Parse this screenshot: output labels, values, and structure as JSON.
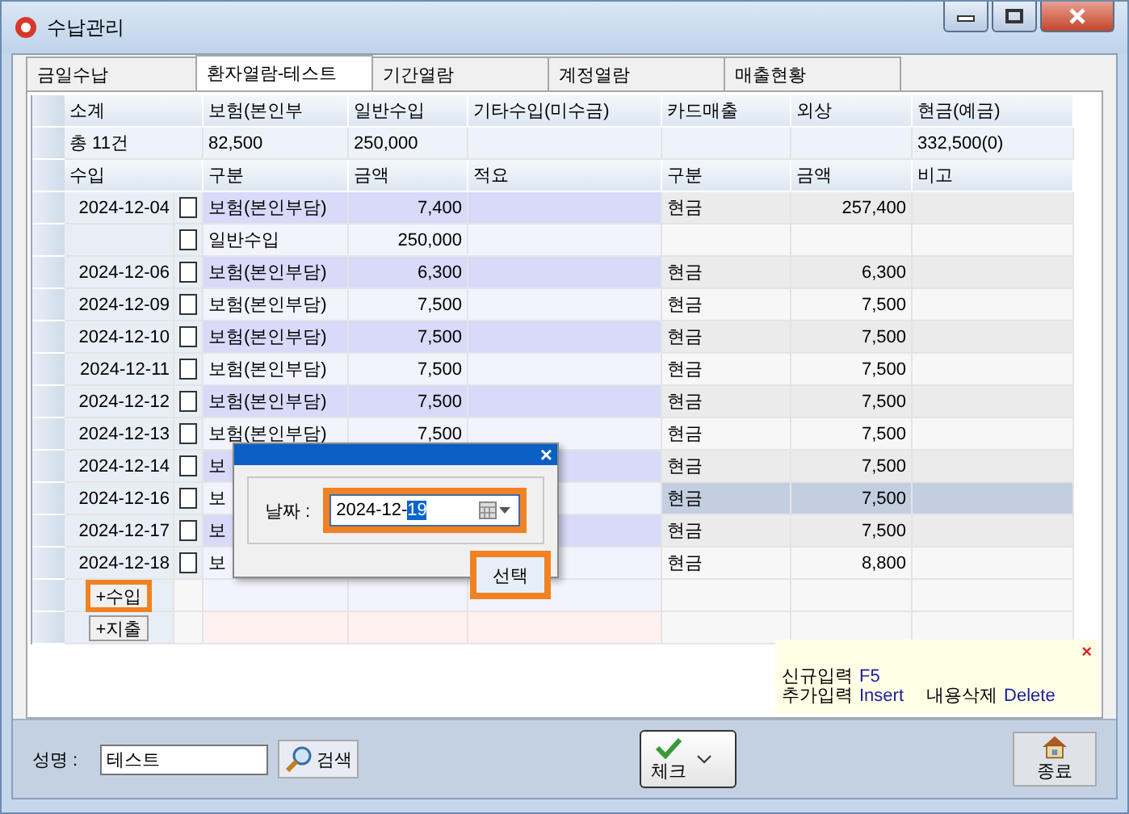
{
  "window": {
    "title": "수납관리"
  },
  "tabs": [
    {
      "label": "금일수납",
      "selected": false
    },
    {
      "label": "환자열람-테스트",
      "selected": true
    },
    {
      "label": "기간열람",
      "selected": false
    },
    {
      "label": "계정열람",
      "selected": false
    },
    {
      "label": "매출현황",
      "selected": false
    }
  ],
  "summary": [
    {
      "label": "소계",
      "value": "총 11건"
    },
    {
      "label": "보험(본인부",
      "value": "82,500"
    },
    {
      "label": "일반수입",
      "value": "250,000"
    },
    {
      "label": "기타수입(미수금)"
    },
    {
      "label": "카드매출"
    },
    {
      "label": "외상"
    },
    {
      "label": "현금(예금)",
      "value": "332,500(0)"
    }
  ],
  "table": {
    "columns": [
      "수입",
      "구분",
      "금액",
      "적요",
      "구분",
      "금액",
      "비고"
    ],
    "rows": [
      {
        "date": "2024-12-04",
        "checked": false,
        "category": "보험(본인부담)",
        "amount": "7,400",
        "pay_type": "현금",
        "pay_amount": "257,400",
        "selected": false
      },
      {
        "checked": false,
        "category": "일반수입",
        "amount": "250,000",
        "selected": false
      },
      {
        "date": "2024-12-06",
        "checked": false,
        "category": "보험(본인부담)",
        "amount": "6,300",
        "pay_type": "현금",
        "pay_amount": "6,300",
        "selected": false
      },
      {
        "date": "2024-12-09",
        "checked": false,
        "category": "보험(본인부담)",
        "amount": "7,500",
        "pay_type": "현금",
        "pay_amount": "7,500",
        "selected": false
      },
      {
        "date": "2024-12-10",
        "checked": false,
        "category": "보험(본인부담)",
        "amount": "7,500",
        "pay_type": "현금",
        "pay_amount": "7,500",
        "selected": false
      },
      {
        "date": "2024-12-11",
        "checked": false,
        "category": "보험(본인부담)",
        "amount": "7,500",
        "pay_type": "현금",
        "pay_amount": "7,500",
        "selected": false
      },
      {
        "date": "2024-12-12",
        "checked": false,
        "category": "보험(본인부담)",
        "amount": "7,500",
        "pay_type": "현금",
        "pay_amount": "7,500",
        "selected": false
      },
      {
        "date": "2024-12-13",
        "checked": false,
        "category": "보험(본인부담)",
        "amount": "7,500",
        "pay_type": "현금",
        "pay_amount": "7,500",
        "selected": false
      },
      {
        "date": "2024-12-14",
        "checked": false,
        "category": "보",
        "pay_type": "현금",
        "pay_amount": "7,500",
        "selected": false
      },
      {
        "date": "2024-12-16",
        "checked": false,
        "category": "보",
        "pay_type": "현금",
        "pay_amount": "7,500",
        "selected": true
      },
      {
        "date": "2024-12-17",
        "checked": false,
        "category": "보",
        "pay_type": "현금",
        "pay_amount": "7,500",
        "selected": false
      },
      {
        "date": "2024-12-18",
        "checked": false,
        "category": "보",
        "pay_type": "현금",
        "pay_amount": "8,800",
        "selected": false
      }
    ],
    "add_buttons": [
      {
        "label": "+수입",
        "highlighted": true
      },
      {
        "label": "+지출",
        "highlighted": false
      }
    ]
  },
  "dialog": {
    "close": "×",
    "label": "날짜 :",
    "date_value": "2024-12-",
    "date_selected": "19",
    "date_highlighted": true,
    "button": "선택",
    "button_highlighted": true
  },
  "help": {
    "close": "×",
    "lines": [
      [
        {
          "label": "신규입력",
          "key": "F5"
        }
      ],
      [
        {
          "label": "추가입력",
          "key": "Insert"
        },
        {
          "label": "내용삭제",
          "key": "Delete"
        }
      ]
    ]
  },
  "footer": {
    "name_label": "성명 :",
    "name_value": "테스트",
    "search": "검색",
    "check": "체크",
    "exit": "종료"
  }
}
